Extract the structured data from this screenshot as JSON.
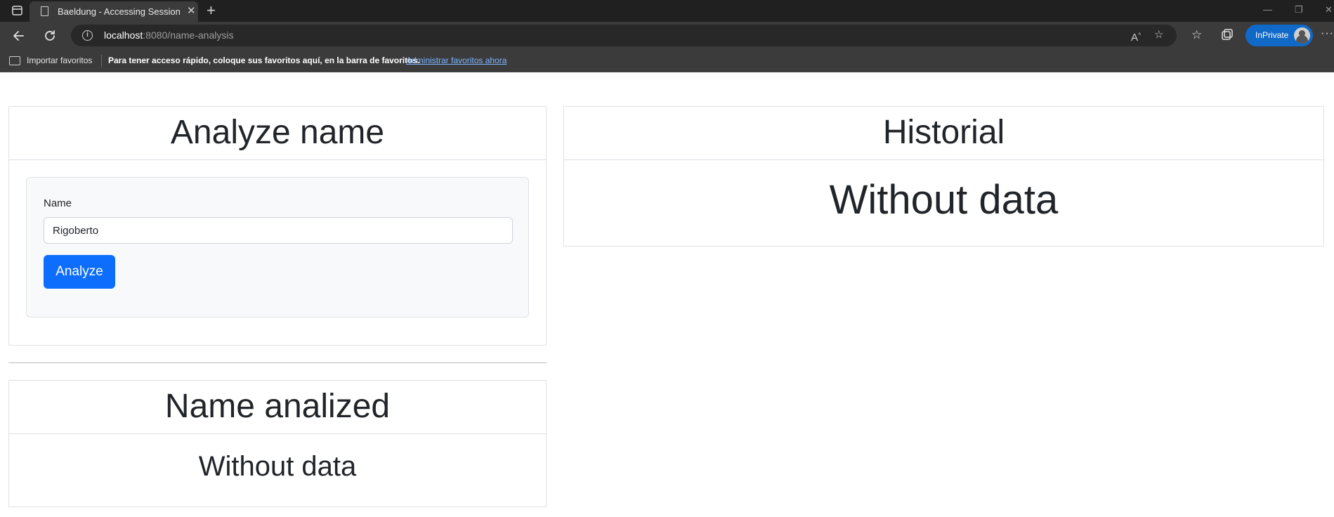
{
  "browser": {
    "tab_title": "Baeldung - Accessing Session Attributes",
    "tab_close": "✕",
    "new_tab": "+",
    "url_host": "localhost",
    "url_rest": ":8080/name-analysis",
    "inprivate_label": "InPrivate",
    "more_label": "···",
    "window_controls": {
      "minimize": "—",
      "restore": "❐",
      "close": "✕"
    },
    "icons": [
      "tab-actions-icon",
      "page-icon",
      "back-icon",
      "refresh-icon",
      "site-info-icon",
      "read-aloud-icon",
      "add-favorite-icon",
      "favorites-icon",
      "collections-icon"
    ]
  },
  "favorites_bar": {
    "import_label": "Importar favoritos",
    "message": "Para tener acceso rápido, coloque sus favoritos aquí, en la barra de favoritos.",
    "manage_link": "Administrar favoritos ahora"
  },
  "analyze_card": {
    "title": "Analyze name",
    "field_label": "Name",
    "field_value": "Rigoberto",
    "button_label": "Analyze"
  },
  "result_card": {
    "title": "Name analized",
    "message": "Without data"
  },
  "history_card": {
    "title": "Historial",
    "message": "Without data"
  },
  "colors": {
    "primary": "#0d6efd",
    "inprivate": "#1068c7",
    "border": "#dee2e6",
    "chrome_dark": "#202020",
    "chrome": "#3b3b3b"
  }
}
